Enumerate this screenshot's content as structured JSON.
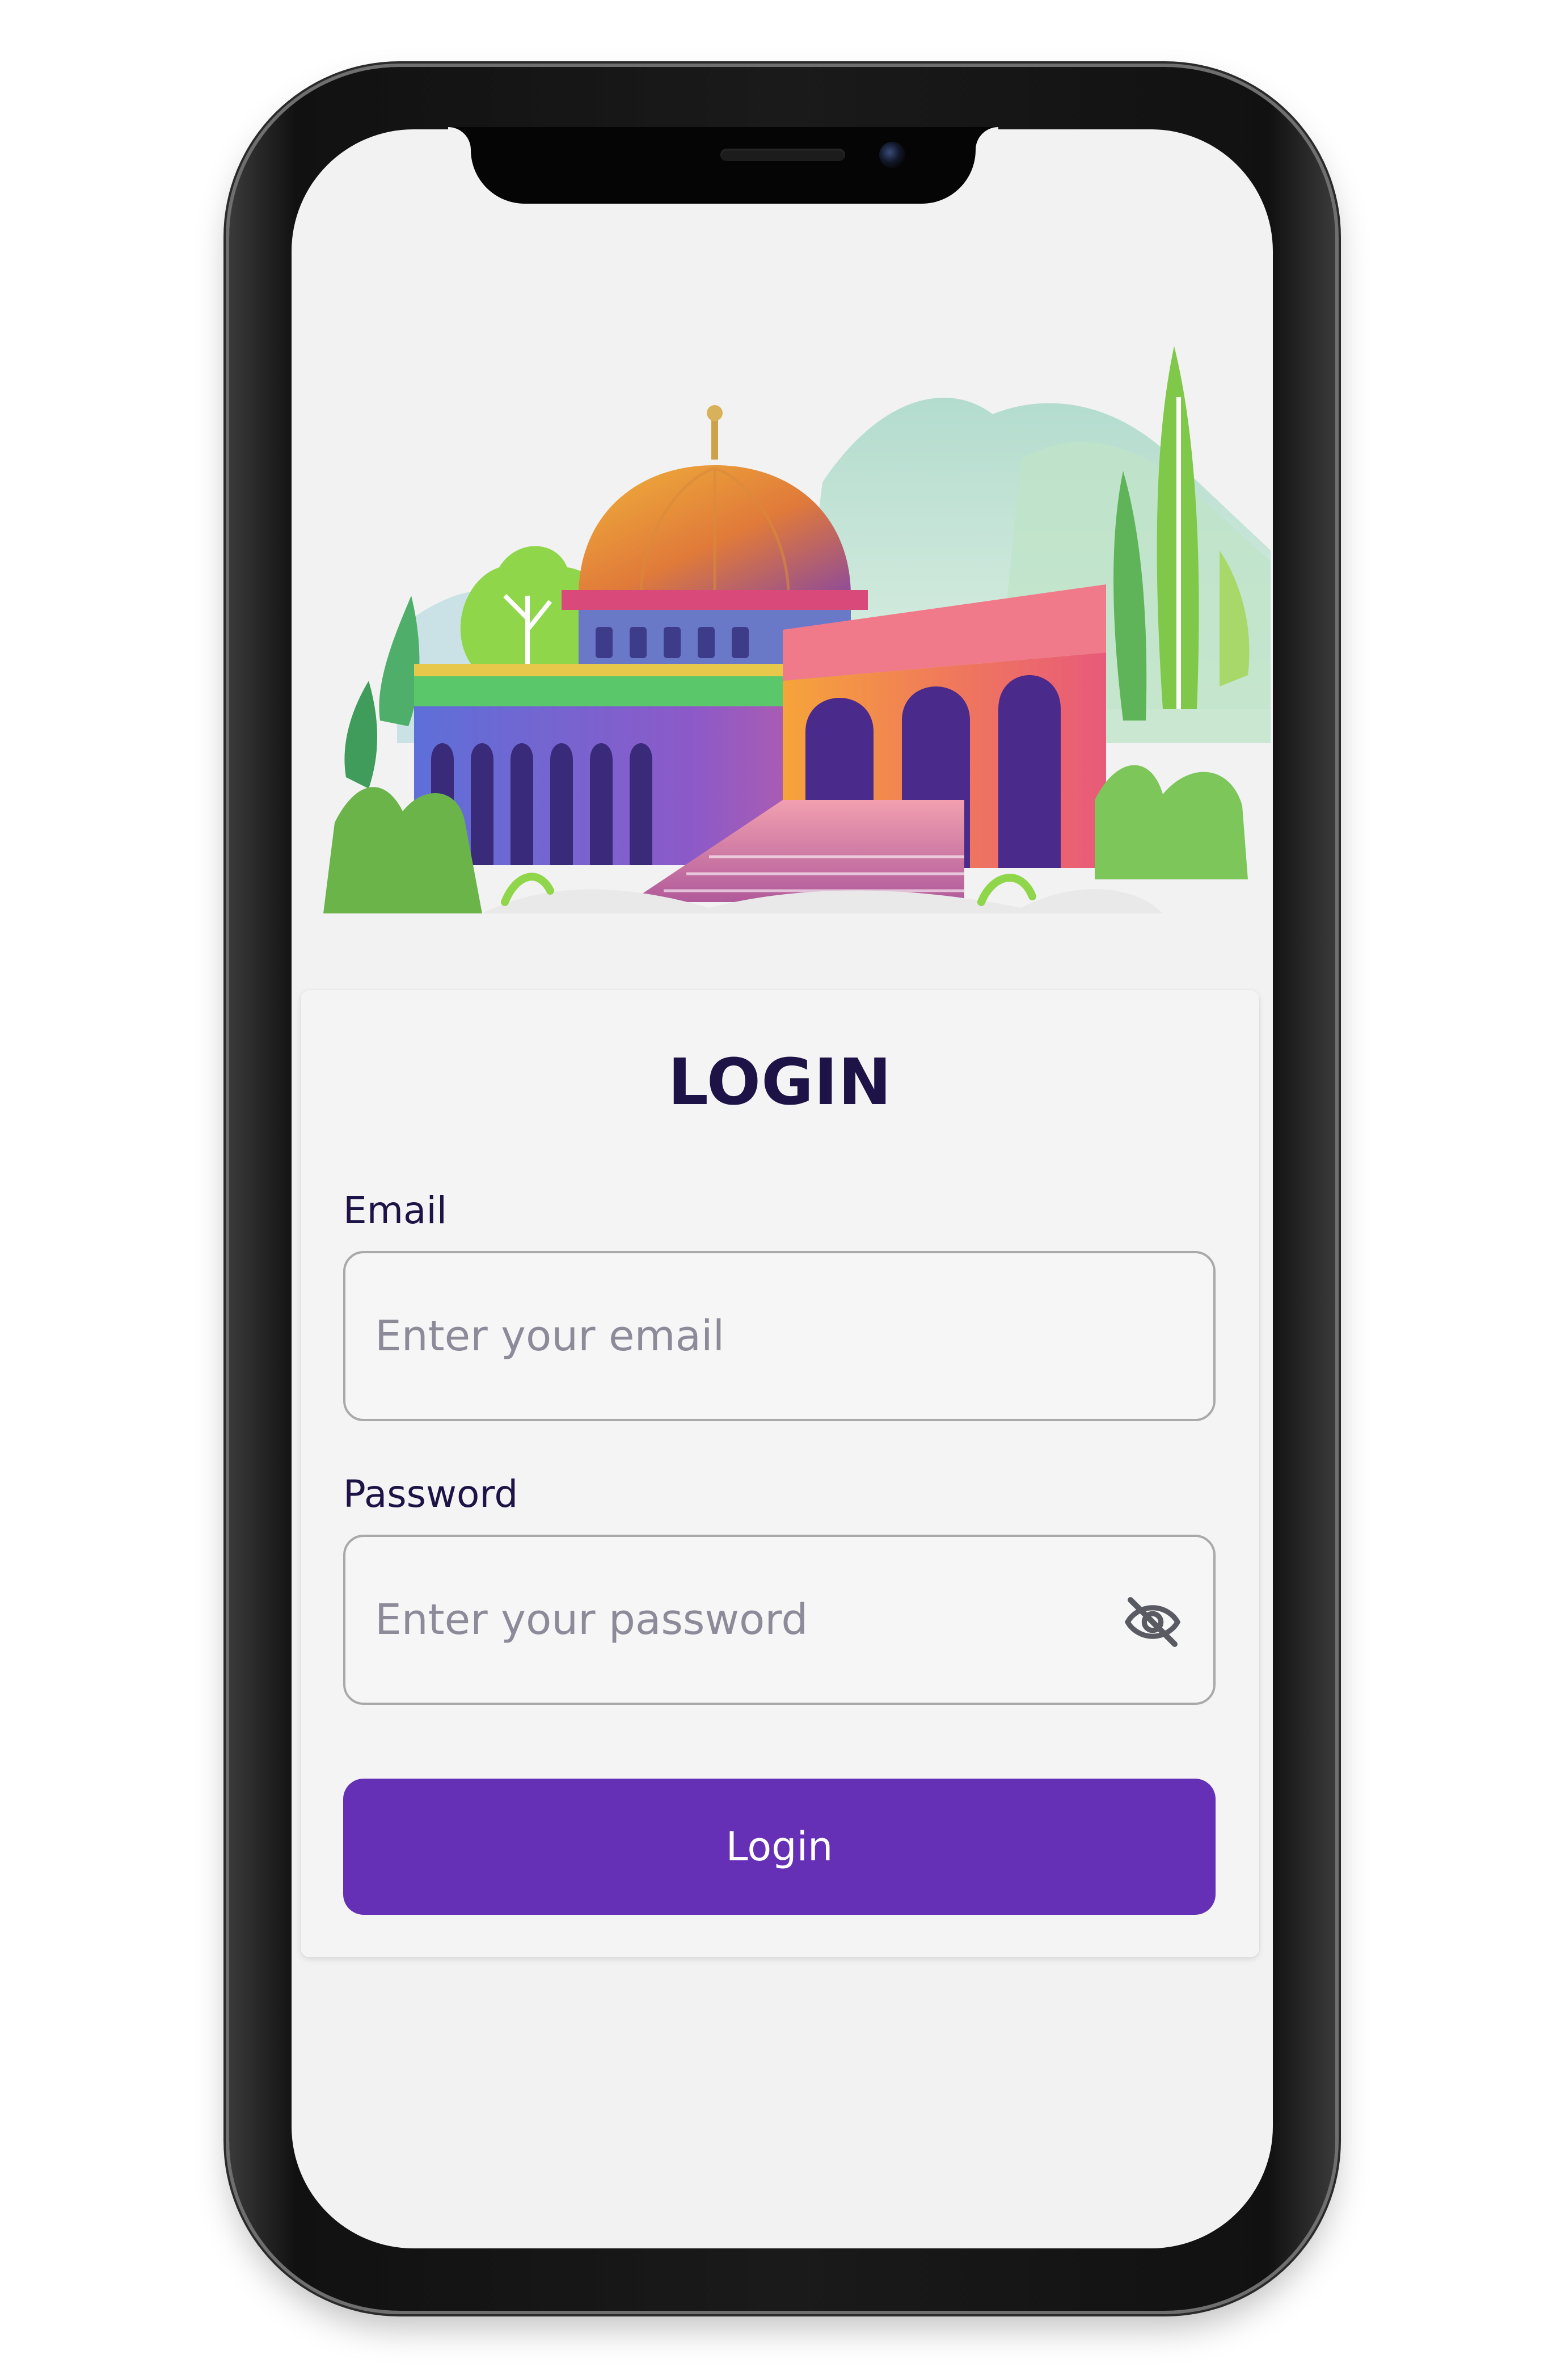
{
  "login": {
    "title": "LOGIN",
    "email": {
      "label": "Email",
      "placeholder": "Enter your email",
      "value": ""
    },
    "password": {
      "label": "Password",
      "placeholder": "Enter your password",
      "value": "",
      "toggle_icon": "eye-off-icon"
    },
    "submit_label": "Login"
  },
  "illustration": {
    "subject": "mosque-illustration"
  },
  "colors": {
    "primary": "#652fb6",
    "title_text": "#1e1346",
    "screen_background": "#f2f2f2",
    "input_border": "#a9a9a9",
    "placeholder": "#8d8a99"
  }
}
